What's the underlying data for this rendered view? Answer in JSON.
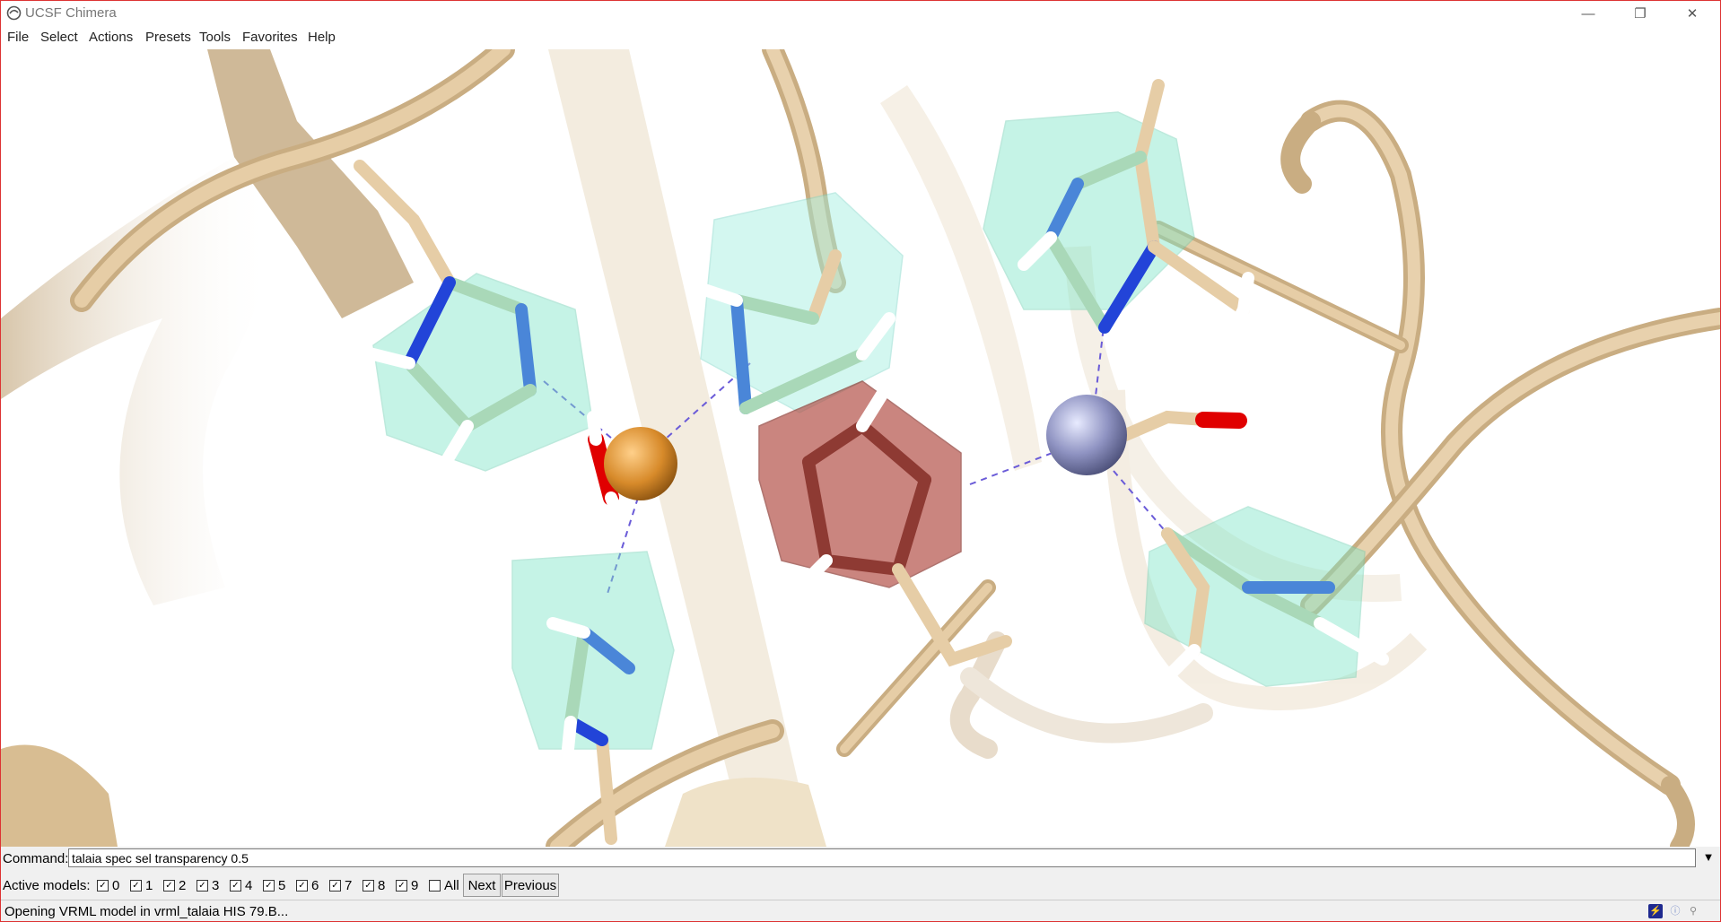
{
  "window": {
    "title": "UCSF Chimera"
  },
  "window_controls": {
    "minimize": "—",
    "restore": "❐",
    "close": "✕"
  },
  "menu": [
    "File",
    "Select",
    "Actions",
    "Presets",
    "Tools",
    "Favorites",
    "Help"
  ],
  "command": {
    "label": "Command:",
    "value": "talaia spec sel transparency 0.5",
    "dropdown": "▼"
  },
  "models": {
    "label": "Active models:",
    "items": [
      {
        "label": "0",
        "checked": true
      },
      {
        "label": "1",
        "checked": true
      },
      {
        "label": "2",
        "checked": true
      },
      {
        "label": "3",
        "checked": true
      },
      {
        "label": "4",
        "checked": true
      },
      {
        "label": "5",
        "checked": true
      },
      {
        "label": "6",
        "checked": true
      },
      {
        "label": "7",
        "checked": true
      },
      {
        "label": "8",
        "checked": true
      },
      {
        "label": "9",
        "checked": true
      },
      {
        "label": "All",
        "checked": false
      }
    ],
    "next": "Next",
    "previous": "Previous"
  },
  "status": {
    "message": "Opening VRML model in vrml_talaia HIS 79.B..."
  },
  "colors": {
    "ribbon": "#e2c9a2",
    "carbon_green": "#a9d8b8",
    "nitrogen": "#1f45d8",
    "oxygen": "#e00000",
    "hydrogen": "#ffffff",
    "polyhedron_green": "#7fe6c8",
    "polyhedron_selected": "#b5524a",
    "copper_ion": "#d78a2a",
    "zinc_ion": "#8f93c2",
    "hbond": "#6a5bd8"
  }
}
